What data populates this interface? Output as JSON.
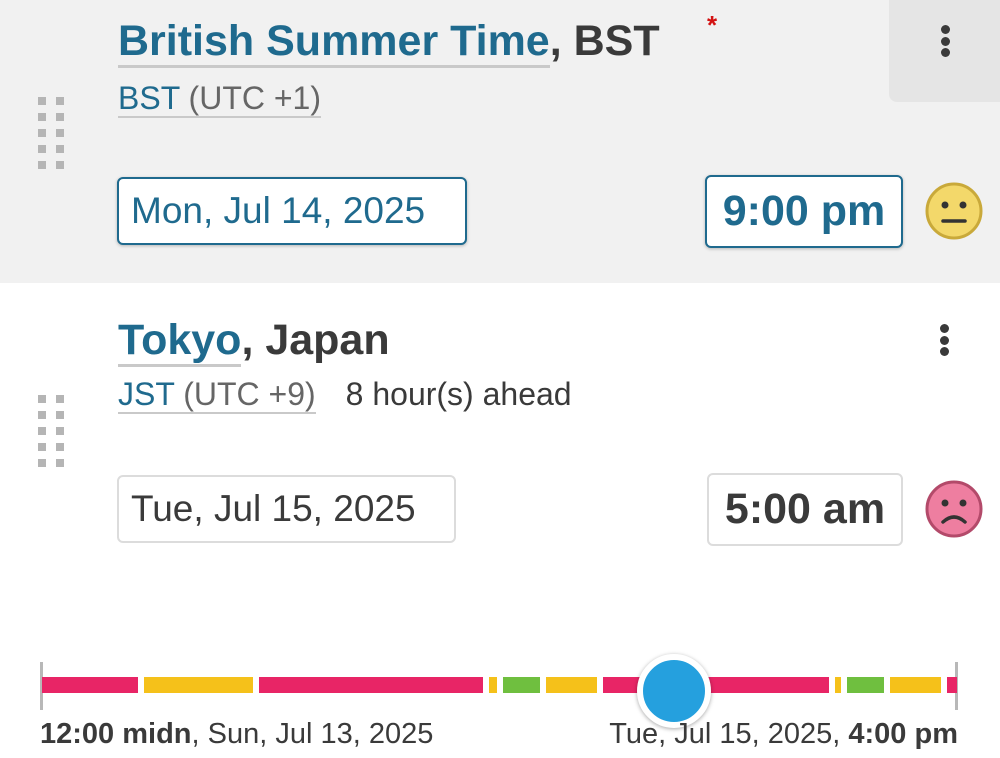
{
  "home": {
    "place": "British Summer Time",
    "region": ", BST",
    "required_mark": "*",
    "tz_abbr": "BST",
    "tz_offset": " (UTC +1)",
    "date": "Mon, Jul 14, 2025",
    "time": "9:00 pm",
    "mood": "neutral-face-icon",
    "mood_color": "#f3d86a"
  },
  "other": {
    "place": "Tokyo",
    "region": ", Japan",
    "tz_abbr": "JST",
    "tz_offset": " (UTC +9)",
    "offset_note": "8 hour(s) ahead",
    "date": "Tue, Jul 15, 2025",
    "time": "5:00 am",
    "mood": "sad-face-icon",
    "mood_color": "#ee7ea0"
  },
  "timeline": {
    "start_time": "12:00 midn",
    "start_date": ", Sun, Jul 13, 2025",
    "end_date": "Tue, Jul 15, 2025, ",
    "end_time": "4:00 pm",
    "knob_position": 0.645,
    "colors": {
      "bad": "#e82566",
      "ok": "#f5c11a",
      "good": "#6fbf3f"
    }
  },
  "icons": {
    "drag": "drag-handle-icon",
    "menu": "more-vert-icon"
  },
  "accent": "#1f6a8e"
}
